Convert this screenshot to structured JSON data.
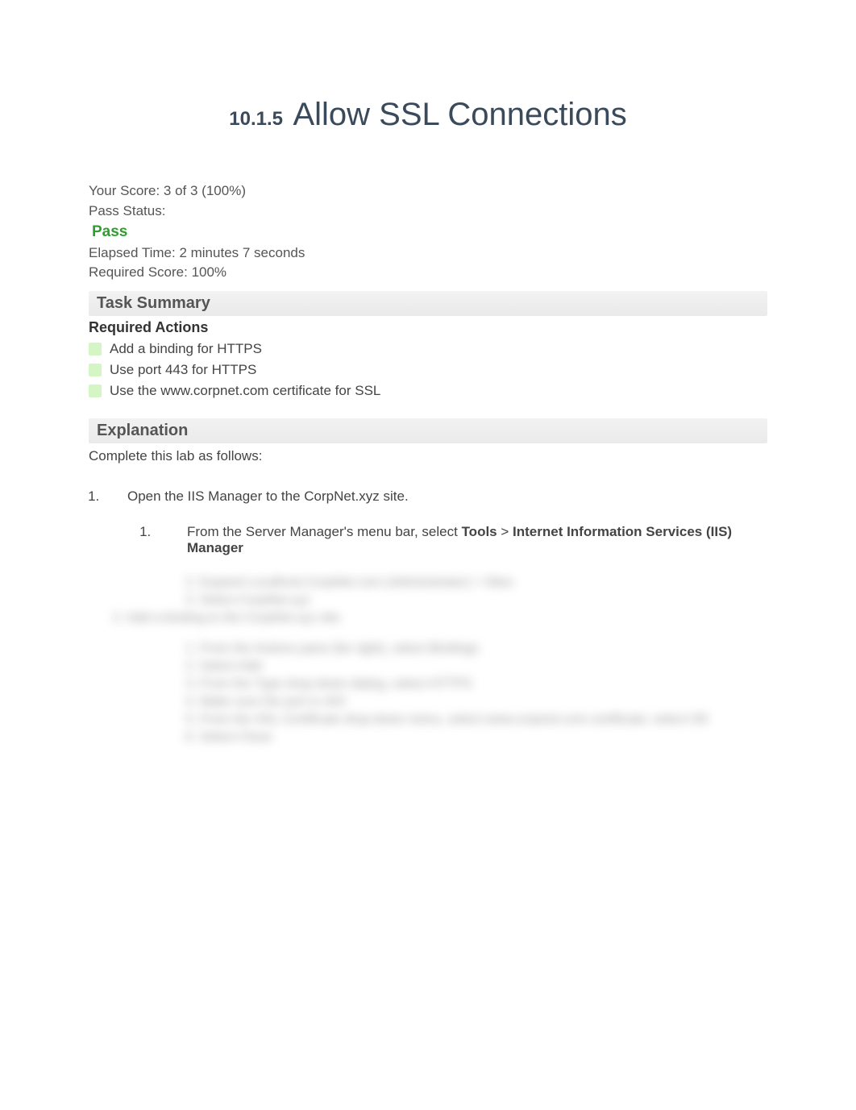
{
  "title": {
    "number": "10.1.5",
    "text": "Allow SSL Connections"
  },
  "score": {
    "line": "Your Score: 3 of 3 (100%)",
    "pass_status_label": "Pass Status:",
    "pass_value": "Pass",
    "elapsed": "Elapsed Time: 2 minutes 7 seconds",
    "required": "Required Score: 100%"
  },
  "sections": {
    "task_summary": "Task Summary",
    "required_actions": "Required Actions",
    "explanation": "Explanation"
  },
  "actions": [
    "Add a binding for HTTPS",
    "Use port 443 for HTTPS",
    "Use the www.corpnet.com certificate for SSL"
  ],
  "explanation_intro": "Complete this lab as follows:",
  "steps": {
    "s1": "Open the IIS Manager to the CorpNet.xyz site.",
    "s1_1_pre": "From the Server Manager's menu bar, select ",
    "s1_1_tools": "Tools",
    "s1_1_gt": " > ",
    "s1_1_iis": "Internet Information Services (IIS) Manager"
  },
  "blur": {
    "l1": "2.        Expand  Localhost.CorpNet.com (Administrator)  >  Sites",
    "l2": "3.        Select  CorpNet.xyz",
    "l3": "2.   Add a binding to the CorpNet.xyz site.",
    "l4": "1.        From the Actions pane (far right), select  Bindings",
    "l5": "2.        Select  Add",
    "l6": "3.        From the Type drop-down dialog, select  HTTPS",
    "l7": "4.        Make sure the port is  443",
    "l8": "5.        From the  SSL Certificate  drop-down menu, select  www.corpnet.com  certificate; select  OK",
    "l9": "6.        Select  Close"
  }
}
